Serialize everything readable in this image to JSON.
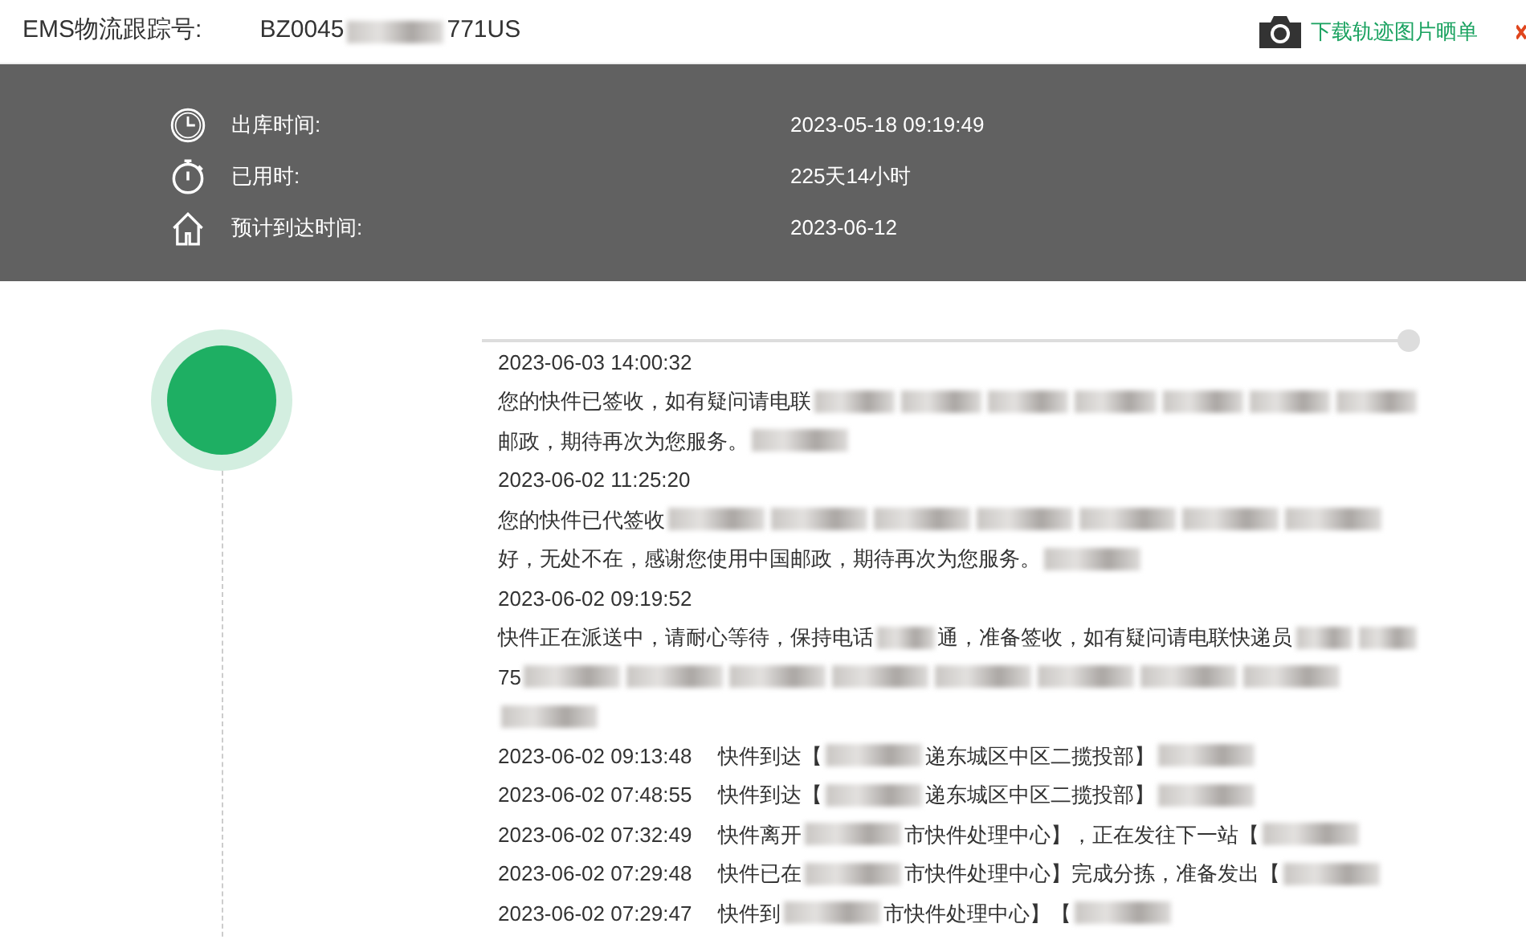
{
  "header": {
    "label": "EMS物流跟踪号:",
    "tracking_parts": [
      {
        "kind": "text",
        "text": "BZ0045"
      },
      {
        "kind": "blur"
      },
      {
        "kind": "text",
        "text": "771US"
      }
    ],
    "download_link": "下载轨迹图片晒单"
  },
  "summary": [
    {
      "label": "出库时间:",
      "value": "2023-05-18 09:19:49"
    },
    {
      "label": "已用时:",
      "value": "225天14小时"
    },
    {
      "label": "预计到达时间:",
      "value": "2023-06-12"
    }
  ],
  "events": [
    {
      "kind": "block",
      "time": "2023-06-03 14:00:32",
      "lines": [
        [
          {
            "kind": "text",
            "text": "您的快件已签收，如有疑问请电联"
          },
          {
            "kind": "blur"
          },
          {
            "kind": "blur"
          },
          {
            "kind": "blur"
          },
          {
            "kind": "blur"
          },
          {
            "kind": "blur"
          },
          {
            "kind": "blur"
          },
          {
            "kind": "blur"
          }
        ],
        [
          {
            "kind": "text",
            "text": "邮政，期待再次为您服务。"
          },
          {
            "kind": "blur"
          }
        ]
      ]
    },
    {
      "kind": "block",
      "time": "2023-06-02 11:25:20",
      "lines": [
        [
          {
            "kind": "text",
            "text": "您的快件已代签收"
          },
          {
            "kind": "blur"
          },
          {
            "kind": "blur"
          },
          {
            "kind": "blur"
          },
          {
            "kind": "blur"
          },
          {
            "kind": "blur"
          },
          {
            "kind": "blur"
          },
          {
            "kind": "blur"
          }
        ],
        [
          {
            "kind": "text",
            "text": "好，无处不在，感谢您使用中国邮政，期待再次为您服务。"
          },
          {
            "kind": "blur"
          }
        ]
      ]
    },
    {
      "kind": "block",
      "time": "2023-06-02 09:19:52",
      "lines": [
        [
          {
            "kind": "text",
            "text": "快件正在派送中，请耐心等待，保持电话"
          },
          {
            "kind": "blur"
          },
          {
            "kind": "text",
            "text": "通，准备签收，如有疑问请电联快递员"
          },
          {
            "kind": "blur"
          },
          {
            "kind": "blur"
          }
        ],
        [
          {
            "kind": "text",
            "text": "75"
          },
          {
            "kind": "blur"
          },
          {
            "kind": "blur"
          },
          {
            "kind": "blur"
          },
          {
            "kind": "blur"
          },
          {
            "kind": "blur"
          },
          {
            "kind": "blur"
          },
          {
            "kind": "blur"
          },
          {
            "kind": "blur"
          }
        ],
        [
          {
            "kind": "blur"
          }
        ]
      ]
    },
    {
      "kind": "inline",
      "time": "2023-06-02 09:13:48",
      "lines": [
        [
          {
            "kind": "text",
            "text": "快件到达【"
          },
          {
            "kind": "blur"
          },
          {
            "kind": "text",
            "text": "递东城区中区二揽投部】"
          },
          {
            "kind": "blur"
          }
        ]
      ]
    },
    {
      "kind": "inline",
      "time": "2023-06-02 07:48:55",
      "lines": [
        [
          {
            "kind": "text",
            "text": "快件到达【"
          },
          {
            "kind": "blur"
          },
          {
            "kind": "text",
            "text": "递东城区中区二揽投部】"
          },
          {
            "kind": "blur"
          }
        ]
      ]
    },
    {
      "kind": "inline",
      "time": "2023-06-02 07:32:49",
      "lines": [
        [
          {
            "kind": "text",
            "text": "快件离开"
          },
          {
            "kind": "blur"
          },
          {
            "kind": "text",
            "text": "市快件处理中心】，正在发往下一站【"
          },
          {
            "kind": "blur"
          }
        ]
      ]
    },
    {
      "kind": "inline",
      "time": "2023-06-02 07:29:48",
      "lines": [
        [
          {
            "kind": "text",
            "text": "快件已在"
          },
          {
            "kind": "blur"
          },
          {
            "kind": "text",
            "text": "市快件处理中心】完成分拣，准备发出【"
          },
          {
            "kind": "blur"
          }
        ]
      ]
    },
    {
      "kind": "inline",
      "time": "2023-06-02 07:29:47",
      "lines": [
        [
          {
            "kind": "text",
            "text": "快件到"
          },
          {
            "kind": "blur"
          },
          {
            "kind": "text",
            "text": "市快件处理中心】【"
          },
          {
            "kind": "blur"
          }
        ]
      ]
    }
  ]
}
